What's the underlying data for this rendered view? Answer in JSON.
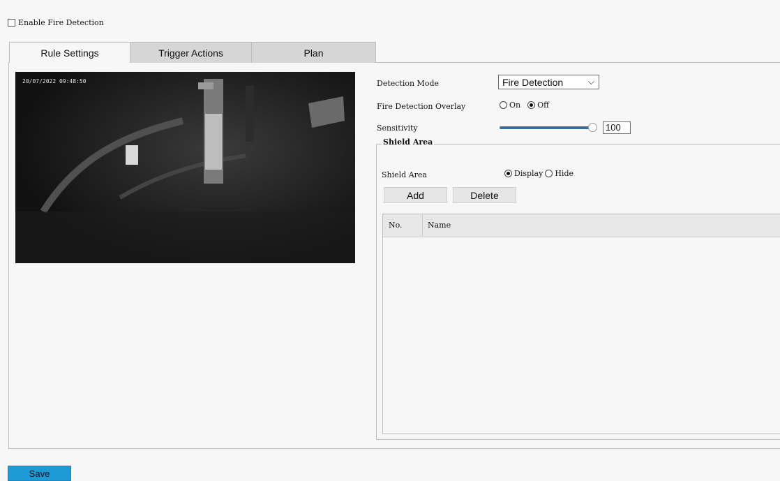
{
  "enable_fire_detection": {
    "label": "Enable Fire Detection",
    "checked": false
  },
  "tabs": [
    {
      "label": "Rule Settings",
      "active": true
    },
    {
      "label": "Trigger Actions",
      "active": false
    },
    {
      "label": "Plan",
      "active": false
    }
  ],
  "video": {
    "timestamp": "20/07/2022 09:48:50"
  },
  "detection_mode": {
    "label": "Detection Mode",
    "value": "Fire Detection"
  },
  "fire_detection_overlay": {
    "label": "Fire Detection Overlay",
    "options": [
      "On",
      "Off"
    ],
    "selected": "Off"
  },
  "sensitivity": {
    "label": "Sensitivity",
    "value": "100",
    "level": 1.0
  },
  "shield_area": {
    "legend": "Shield Area",
    "label": "Shield Area",
    "options": [
      "Display",
      "Hide"
    ],
    "selected": "Display",
    "add_label": "Add",
    "delete_label": "Delete",
    "columns": [
      "No.",
      "Name"
    ]
  },
  "save_label": "Save",
  "colors": {
    "accent": "#1e9ad6",
    "slider": "#3b6c9c"
  }
}
